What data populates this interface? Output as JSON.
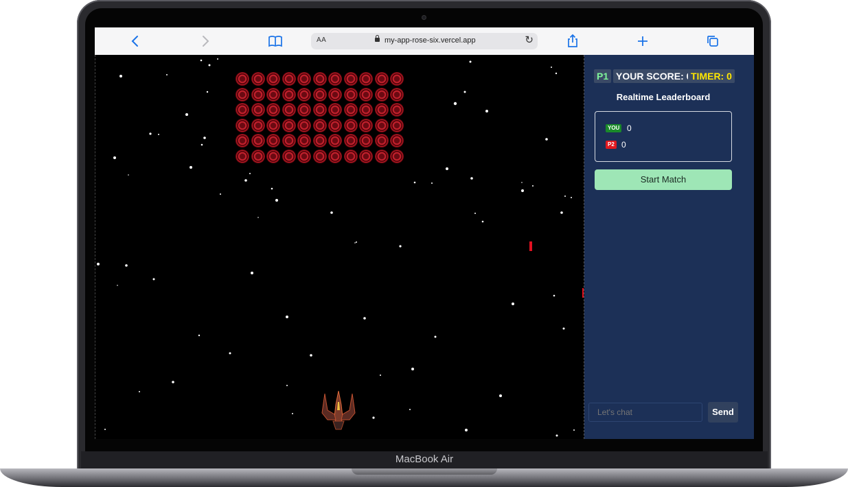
{
  "browser": {
    "text_size_label": "AA",
    "url": "my-app-rose-six.vercel.app",
    "icons": [
      "back-icon",
      "forward-icon",
      "bookmarks-icon",
      "lock-icon",
      "reload-icon",
      "share-icon",
      "new-tab-icon",
      "tabs-icon"
    ]
  },
  "device": {
    "label": "MacBook Air"
  },
  "scoreboard": {
    "player_tag": "P1",
    "score_label": "YOUR SCORE: 0",
    "timer_label": "TIMER: 0",
    "colors": {
      "player_tag": "#7ef59a",
      "score": "#ffffff",
      "timer": "#ffe600"
    }
  },
  "leaderboard": {
    "title": "Realtime Leaderboard",
    "entries": [
      {
        "tag": "YOU",
        "score": "0",
        "tag_color": "#1a8a2a"
      },
      {
        "tag": "P2",
        "score": "0",
        "tag_color": "#e0191f"
      }
    ]
  },
  "actions": {
    "start_label": "Start Match"
  },
  "chat": {
    "placeholder": "Let's chat",
    "send_label": "Send"
  },
  "game": {
    "enemy_grid": {
      "rows": 6,
      "cols": 11
    },
    "player_ship": "spaceship-icon",
    "enemy_icon": "virus-icon",
    "colors": {
      "background": "#000000",
      "enemy": "#c0202c",
      "bullet": "#e01020",
      "panel": "#1c3057"
    }
  }
}
